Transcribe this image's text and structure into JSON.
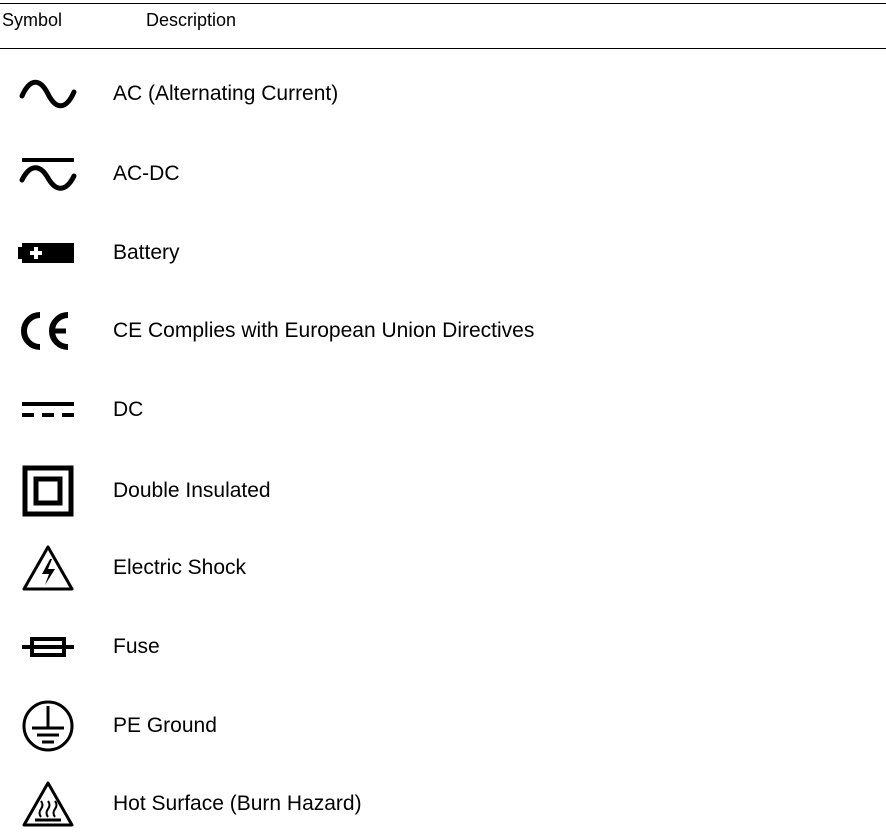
{
  "header": {
    "symbol_label": "Symbol",
    "description_label": "Description"
  },
  "rows": [
    {
      "icon": "ac-sine-wave-icon",
      "description": "AC (Alternating Current)"
    },
    {
      "icon": "ac-dc-icon",
      "description": "AC-DC"
    },
    {
      "icon": "battery-icon",
      "description": "Battery"
    },
    {
      "icon": "ce-mark-icon",
      "description": "CE Complies with European Union Directives"
    },
    {
      "icon": "dc-icon",
      "description": "DC"
    },
    {
      "icon": "double-insulated-icon",
      "description": "Double Insulated"
    },
    {
      "icon": "electric-shock-warning-icon",
      "description": "Electric Shock"
    },
    {
      "icon": "fuse-icon",
      "description": "Fuse"
    },
    {
      "icon": "pe-ground-icon",
      "description": "PE Ground"
    },
    {
      "icon": "hot-surface-warning-icon",
      "description": "Hot Surface (Burn Hazard)"
    }
  ]
}
